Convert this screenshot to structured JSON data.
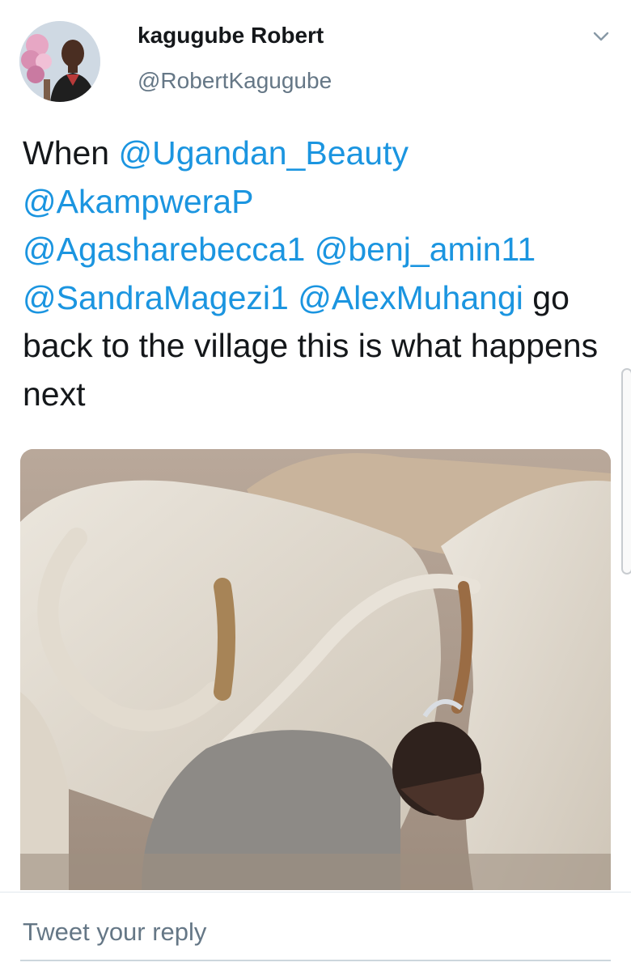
{
  "tweet": {
    "author": {
      "display_name": "kagugube Robert",
      "handle": "@RobertKagugube"
    },
    "text": {
      "lead": "When ",
      "mentions": [
        "@Ugandan_Beauty",
        "@AkampweraP",
        "@Agasharebecca1",
        "@benj_amin11",
        "@SandraMagezi1",
        "@AlexMuhangi"
      ],
      "tail": " go back to the village this is what happens next"
    },
    "menu_icon": "chevron-down-icon",
    "media": {
      "kind": "photo"
    }
  },
  "reply": {
    "placeholder": "Tweet your reply"
  },
  "colors": {
    "text": "#14171a",
    "secondary": "#657786",
    "link": "#1b95e0",
    "divider": "#e1e8ed"
  }
}
